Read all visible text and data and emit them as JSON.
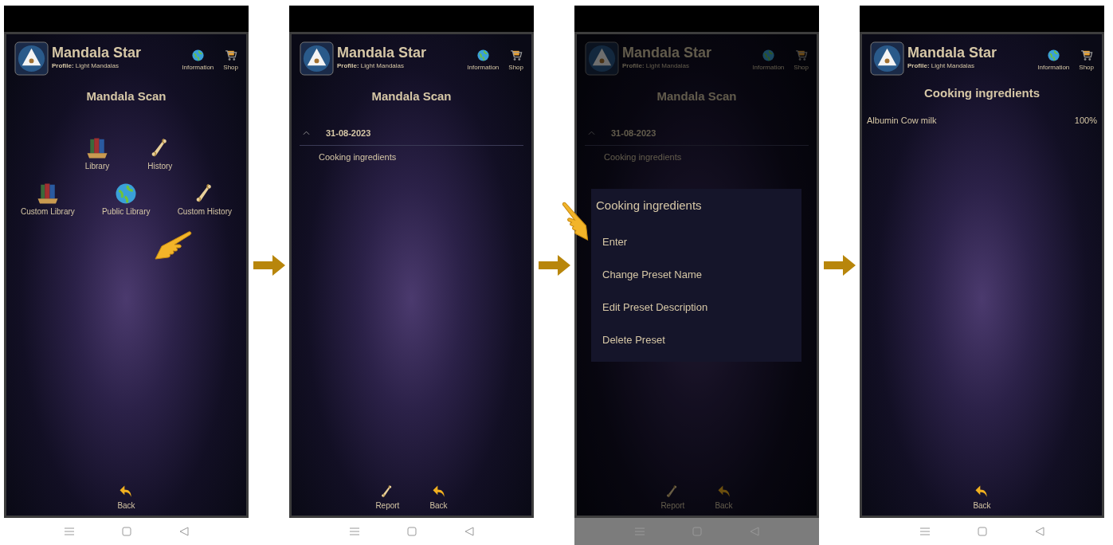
{
  "screens": [
    {
      "kind": "menu",
      "dimmed": false,
      "pointer": true,
      "header": {
        "app_title": "Mandala Star",
        "profile": "**Profile:** Light Mandalas",
        "actions": [
          {
            "label": "Information",
            "kind": "globe"
          },
          {
            "label": "Shop",
            "kind": "cart"
          }
        ]
      },
      "title": "Mandala Scan",
      "menu_rows": [
        [
          {
            "label": "Library",
            "kind": "books"
          },
          {
            "label": "History",
            "kind": "scroll"
          }
        ],
        [
          {
            "label": "Custom Library",
            "kind": "books"
          },
          {
            "label": "Public Library",
            "kind": "globe"
          },
          {
            "label": "Custom History",
            "kind": "scroll"
          }
        ]
      ],
      "bottom_actions": [
        {
          "label": "Back",
          "kind": "back"
        }
      ]
    },
    {
      "kind": "list",
      "dimmed": false,
      "pointer": false,
      "header": {
        "app_title": "Mandala Star",
        "profile": "**Profile:** Light Mandalas",
        "actions": [
          {
            "label": "Information",
            "kind": "globe"
          },
          {
            "label": "Shop",
            "kind": "cart"
          }
        ]
      },
      "title": "Mandala Scan",
      "groups": [
        {
          "label": "31-08-2023",
          "expanded": true,
          "children": [
            "Cooking ingredients"
          ]
        }
      ],
      "bottom_actions": [
        {
          "label": "Report",
          "kind": "scroll"
        },
        {
          "label": "Back",
          "kind": "back"
        }
      ]
    },
    {
      "kind": "list",
      "dimmed": true,
      "pointer": true,
      "header": {
        "app_title": "Mandala Star",
        "profile": "**Profile:** Light Mandalas",
        "actions": [
          {
            "label": "Information",
            "kind": "globe"
          },
          {
            "label": "Shop",
            "kind": "cart"
          }
        ]
      },
      "title": "Mandala Scan",
      "groups": [
        {
          "label": "31-08-2023",
          "expanded": true,
          "children": [
            "Cooking ingredients"
          ]
        }
      ],
      "dialog": {
        "title": "Cooking ingredients",
        "options": [
          "Enter",
          "Change Preset Name",
          "Edit Preset Description",
          "Delete Preset"
        ]
      },
      "bottom_actions": [
        {
          "label": "Report",
          "kind": "scroll"
        },
        {
          "label": "Back",
          "kind": "back"
        }
      ]
    },
    {
      "kind": "detail",
      "dimmed": false,
      "pointer": false,
      "header": {
        "app_title": "Mandala Star",
        "profile": "**Profile:** Light Mandalas",
        "actions": [
          {
            "label": "Information",
            "kind": "globe"
          },
          {
            "label": "Shop",
            "kind": "cart"
          }
        ]
      },
      "title": "Cooking ingredients",
      "items": [
        {
          "name": "Albumin Cow milk",
          "value": "100%"
        }
      ],
      "bottom_actions": [
        {
          "label": "Back",
          "kind": "back"
        }
      ]
    }
  ]
}
